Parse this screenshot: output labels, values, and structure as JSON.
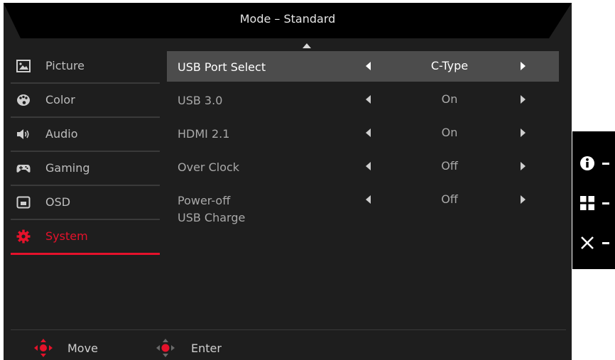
{
  "osd": {
    "title": "Mode – Standard"
  },
  "menu": {
    "items": [
      {
        "label": "Picture",
        "icon": "picture-icon",
        "active": false
      },
      {
        "label": "Color",
        "icon": "palette-icon",
        "active": false
      },
      {
        "label": "Audio",
        "icon": "speaker-icon",
        "active": false
      },
      {
        "label": "Gaming",
        "icon": "gamepad-icon",
        "active": false
      },
      {
        "label": "OSD",
        "icon": "osd-icon",
        "active": false
      },
      {
        "label": "System",
        "icon": "gear-icon",
        "active": true
      }
    ]
  },
  "settings": {
    "rows": [
      {
        "name": "USB Port Select",
        "value": "C-Type",
        "selected": true
      },
      {
        "name": "USB 3.0",
        "value": "On",
        "selected": false
      },
      {
        "name": "HDMI 2.1",
        "value": "On",
        "selected": false
      },
      {
        "name": "Over Clock",
        "value": "Off",
        "selected": false
      },
      {
        "name_line1": "Power-off",
        "name_line2": "USB Charge",
        "value": "Off",
        "selected": false
      }
    ]
  },
  "footer": {
    "move_label": "Move",
    "enter_label": "Enter"
  },
  "side_panel": {
    "buttons": [
      "info-icon",
      "menu-grid-icon",
      "close-icon"
    ]
  },
  "colors": {
    "accent": "#e5122b",
    "panel_bg": "#1e1e1e",
    "selected_row_bg": "#4c4c4c"
  }
}
